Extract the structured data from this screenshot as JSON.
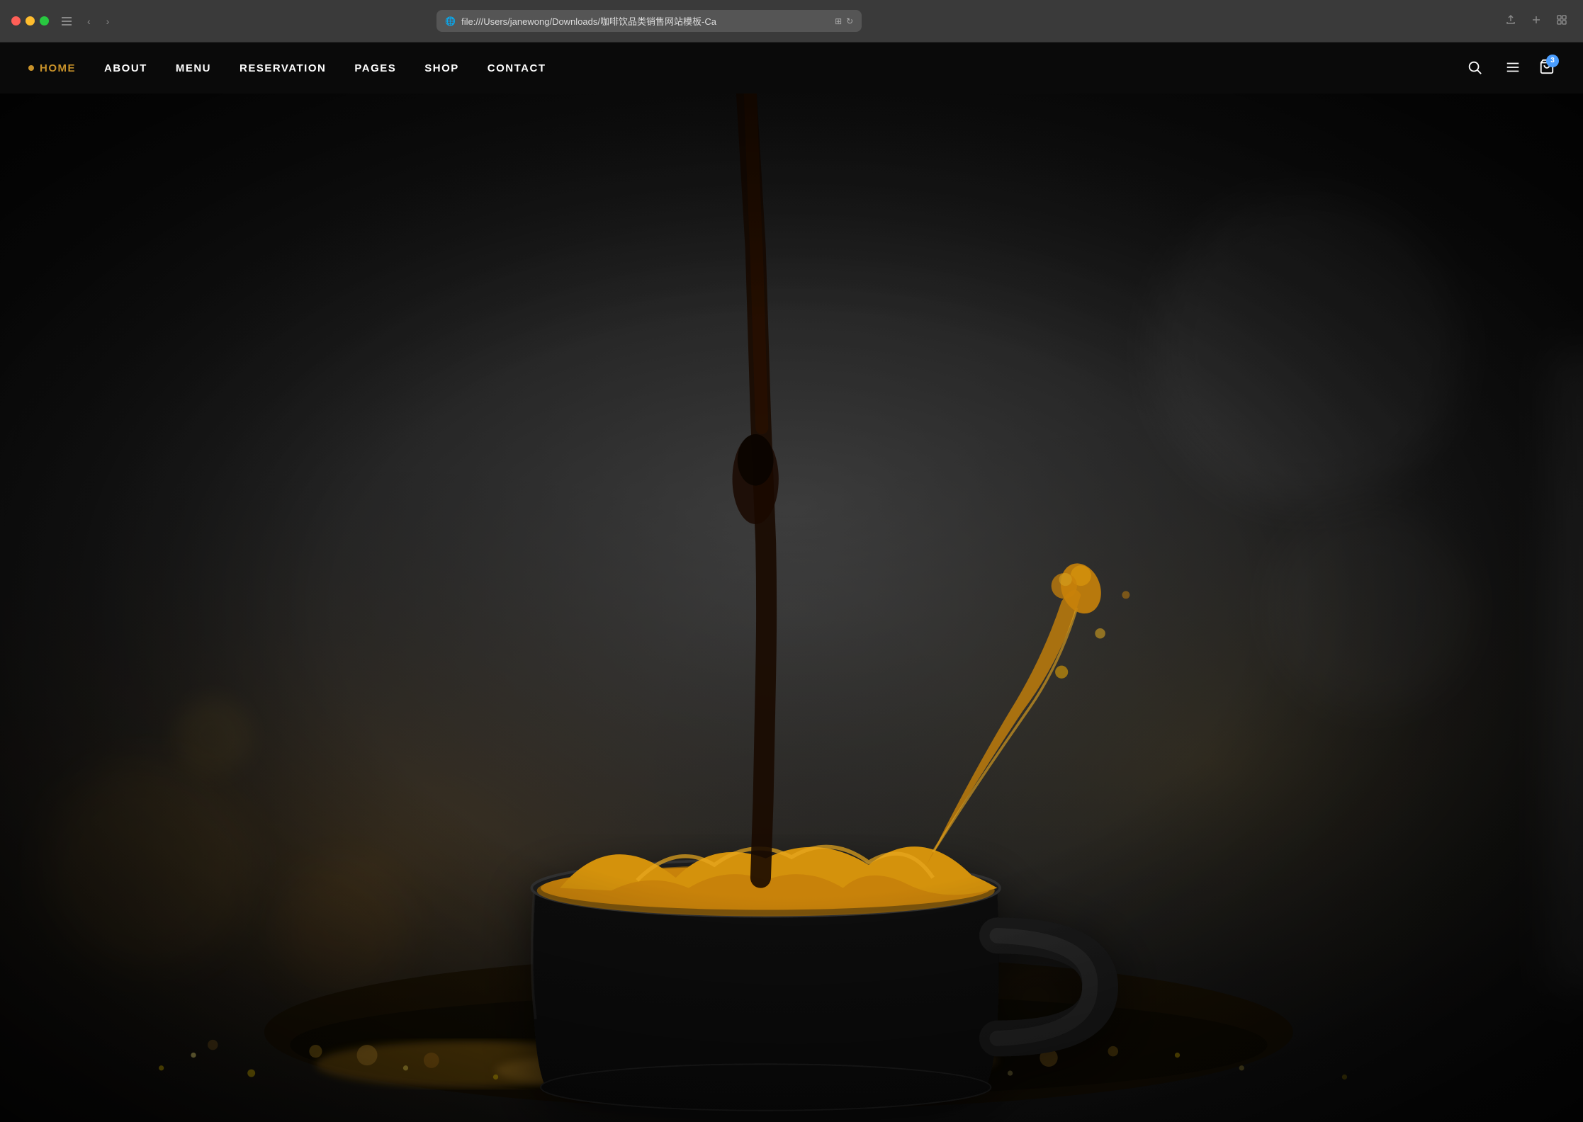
{
  "browser": {
    "url": "file:///Users/janewong/Downloads/咖啡饮品类销售网站模板-Ca",
    "tab_title": "咖啡饮品类销售网站模板"
  },
  "navbar": {
    "logo_dot": "●",
    "items": [
      {
        "id": "home",
        "label": "HOME",
        "active": true
      },
      {
        "id": "about",
        "label": "ABOUT",
        "active": false
      },
      {
        "id": "menu",
        "label": "MENU",
        "active": false
      },
      {
        "id": "reservation",
        "label": "RESERVATION",
        "active": false
      },
      {
        "id": "pages",
        "label": "PAGES",
        "active": false
      },
      {
        "id": "shop",
        "label": "SHOP",
        "active": false
      },
      {
        "id": "contact",
        "label": "CONTACT",
        "active": false
      }
    ],
    "cart_count": "3"
  },
  "hero": {
    "background_description": "Black coffee cup with golden splash on dark moody background"
  },
  "colors": {
    "navbar_bg": "#0a0a0a",
    "nav_active": "#c8922a",
    "cart_badge": "#4a9eff",
    "white": "#ffffff",
    "hero_dark": "#1a1a1a"
  }
}
